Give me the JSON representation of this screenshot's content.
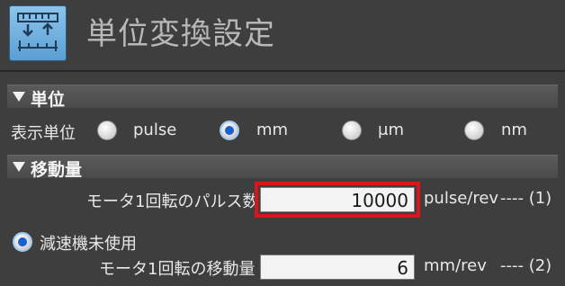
{
  "header": {
    "title": "単位変換設定",
    "icon": "unit-conversion-icon"
  },
  "unit_section": {
    "title": "単位",
    "display_unit_label": "表示単位",
    "options": [
      {
        "label": "pulse",
        "selected": false
      },
      {
        "label": "mm",
        "selected": true
      },
      {
        "label": "μm",
        "selected": false
      },
      {
        "label": "nm",
        "selected": false
      }
    ]
  },
  "movement_section": {
    "title": "移動量",
    "pulses_per_rev": {
      "label": "モータ1回転のパルス数",
      "value": "10000",
      "unit": "pulse/rev",
      "ref": "---- (1)"
    },
    "no_reducer": {
      "label": "減速機未使用",
      "selected": true
    },
    "travel_per_rev": {
      "label": "モータ1回転の移動量",
      "value": "6",
      "unit": "mm/rev",
      "ref": "---- (2)"
    }
  },
  "colors": {
    "background": "#3e3e3e",
    "highlight": "#d9161c",
    "radio_selected": "#1a5fd0"
  }
}
